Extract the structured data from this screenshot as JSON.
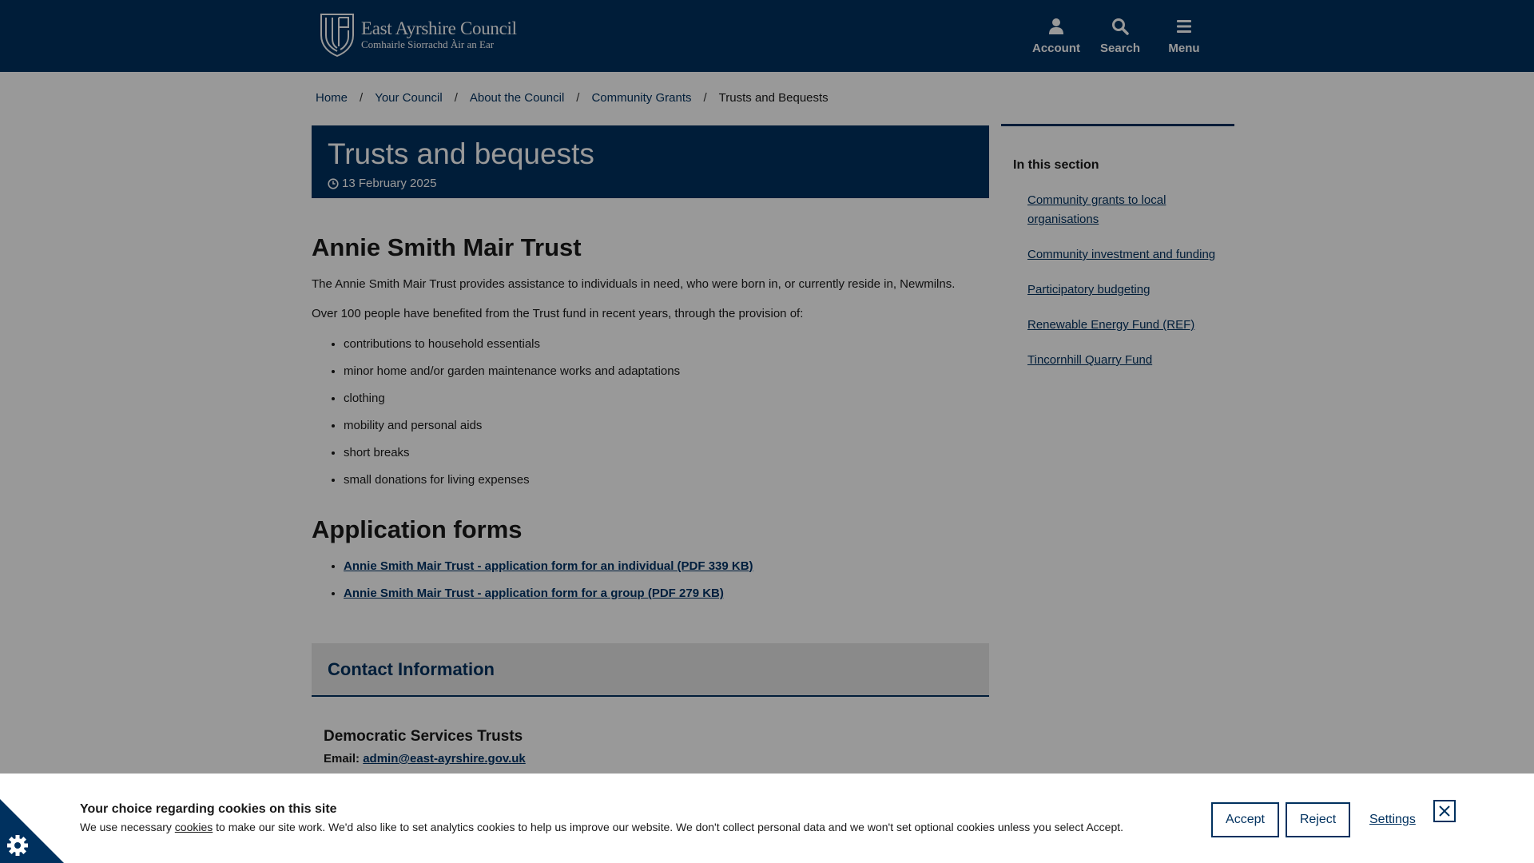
{
  "header": {
    "logo_name": "East Ayrshire Council",
    "logo_gaelic": "Comhairle Siorrachd Àir an Ear",
    "nav": [
      {
        "label": "Account",
        "icon": "user-icon"
      },
      {
        "label": "Search",
        "icon": "search-icon"
      },
      {
        "label": "Menu",
        "icon": "hamburger-icon"
      }
    ]
  },
  "breadcrumb": {
    "items": [
      "Home",
      "Your Council",
      "About the Council",
      "Community Grants"
    ],
    "current": "Trusts and Bequests",
    "separator": "/"
  },
  "page": {
    "title": "Trusts and bequests",
    "date": "13 February 2025"
  },
  "main": {
    "heading1": "Annie Smith Mair Trust",
    "para1": "The Annie Smith Mair Trust provides assistance to individuals in need, who were born in, or currently reside in, Newmilns.",
    "para2": "Over 100 people have benefited from the Trust fund in recent years, through the provision of:",
    "list": [
      "contributions to household essentials",
      "minor home and/or garden maintenance works and adaptations",
      "clothing",
      "mobility and personal aids",
      "short breaks",
      "small donations for living expenses"
    ],
    "heading2": "Application forms",
    "forms": [
      "Annie Smith Mair Trust - application form for an individual (PDF 339 KB)",
      "Annie Smith Mair Trust - application form for a group (PDF 279 KB)"
    ]
  },
  "contact": {
    "heading": "Contact Information",
    "name": "Democratic Services Trusts",
    "email_label": "Email:",
    "email": "admin@east-ayrshire.gov.uk"
  },
  "sidebar": {
    "title": "In this section",
    "items": [
      "Community grants to local organisations",
      "Community investment and funding",
      "Participatory budgeting",
      "Renewable Energy Fund (REF)",
      "Tincornhill Quarry Fund"
    ]
  },
  "cookie": {
    "title": "Your choice regarding cookies on this site",
    "text_before": "We use necessary ",
    "link": "cookies",
    "text_after": " to make our site work. We'd also like to set analytics cookies to help us improve our website. We don't collect personal data and we won't set optional cookies unless you select Accept.",
    "accept": "Accept",
    "reject": "Reject",
    "settings": "Settings"
  },
  "colors": {
    "brand_navy": "#00315f",
    "panel_grey": "#e6e6e6"
  }
}
